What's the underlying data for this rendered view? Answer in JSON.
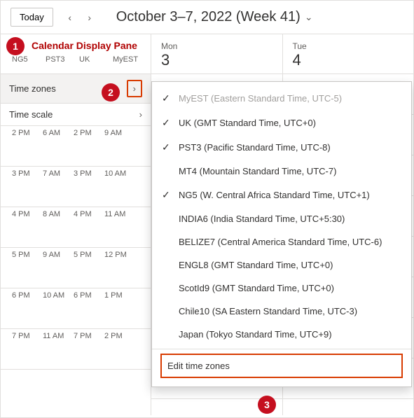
{
  "annotation": {
    "badge1": "1",
    "badge2": "2",
    "badge3": "3",
    "pane_label": "Calendar Display Pane"
  },
  "toolbar": {
    "today": "Today",
    "date_range": "October 3–7, 2022 (Week 41)"
  },
  "tz_columns": [
    "NG5",
    "PST3",
    "UK",
    "MyEST"
  ],
  "days": [
    {
      "name": "Mon",
      "num": "3"
    },
    {
      "name": "Tue",
      "num": "4"
    }
  ],
  "config_rows": {
    "time_zones": "Time zones",
    "time_scale": "Time scale"
  },
  "time_grid": [
    [
      "2 PM",
      "6 AM",
      "2 PM",
      "9 AM"
    ],
    [
      "3 PM",
      "7 AM",
      "3 PM",
      "10 AM"
    ],
    [
      "4 PM",
      "8 AM",
      "4 PM",
      "11 AM"
    ],
    [
      "5 PM",
      "9 AM",
      "5 PM",
      "12 PM"
    ],
    [
      "6 PM",
      "10 AM",
      "6 PM",
      "1 PM"
    ],
    [
      "7 PM",
      "11 AM",
      "7 PM",
      "2 PM"
    ]
  ],
  "dropdown": {
    "items": [
      {
        "checked": true,
        "disabled": true,
        "label": "MyEST (Eastern Standard Time, UTC-5)"
      },
      {
        "checked": true,
        "disabled": false,
        "label": "UK (GMT Standard Time, UTC+0)"
      },
      {
        "checked": true,
        "disabled": false,
        "label": "PST3 (Pacific Standard Time, UTC-8)"
      },
      {
        "checked": false,
        "disabled": false,
        "label": "MT4 (Mountain Standard Time, UTC-7)"
      },
      {
        "checked": true,
        "disabled": false,
        "label": "NG5 (W. Central Africa Standard Time, UTC+1)"
      },
      {
        "checked": false,
        "disabled": false,
        "label": "INDIA6 (India Standard Time, UTC+5:30)"
      },
      {
        "checked": false,
        "disabled": false,
        "label": "BELIZE7 (Central America Standard Time, UTC-6)"
      },
      {
        "checked": false,
        "disabled": false,
        "label": "ENGL8 (GMT Standard Time, UTC+0)"
      },
      {
        "checked": false,
        "disabled": false,
        "label": "ScotId9 (GMT Standard Time, UTC+0)"
      },
      {
        "checked": false,
        "disabled": false,
        "label": "Chile10 (SA Eastern Standard Time, UTC-3)"
      },
      {
        "checked": false,
        "disabled": false,
        "label": "Japan (Tokyo Standard Time, UTC+9)"
      }
    ],
    "edit": "Edit time zones"
  }
}
